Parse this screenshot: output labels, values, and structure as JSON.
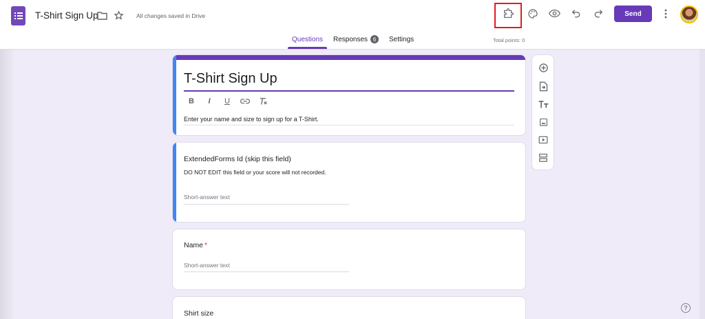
{
  "app": {
    "doc_title": "T-Shirt Sign Up",
    "save_status": "All changes saved in Drive",
    "send_label": "Send"
  },
  "tabs": [
    {
      "label": "Questions",
      "active": true
    },
    {
      "label": "Responses",
      "badge": "6"
    },
    {
      "label": "Settings"
    }
  ],
  "total_points": "Total points: 0",
  "form": {
    "title": "T-Shirt Sign Up",
    "description": "Enter your name and size to sign up for a T-Shirt.",
    "formatting": [
      "B",
      "I",
      "U",
      "link",
      "clear-format"
    ]
  },
  "questions": [
    {
      "title": "ExtendedForms Id (skip this field)",
      "description": "DO NOT EDIT this field or your score will not recorded.",
      "placeholder": "Short-answer text"
    },
    {
      "title": "Name",
      "required_mark": "*",
      "placeholder": "Short-answer text"
    },
    {
      "title": "Shirt size"
    }
  ],
  "side_toolbar": [
    "add-question-icon",
    "import-questions-icon",
    "add-title-icon",
    "add-image-icon",
    "add-video-icon",
    "add-section-icon"
  ],
  "header_icons": [
    "folder-icon",
    "star-icon",
    "addons-icon",
    "palette-icon",
    "preview-eye-icon",
    "undo-icon",
    "redo-icon",
    "more-vert-icon"
  ],
  "colors": {
    "accent": "#673ab7",
    "highlight": "#e41a1a",
    "background": "#f0ebf8",
    "active_bar": "#4285f4"
  }
}
